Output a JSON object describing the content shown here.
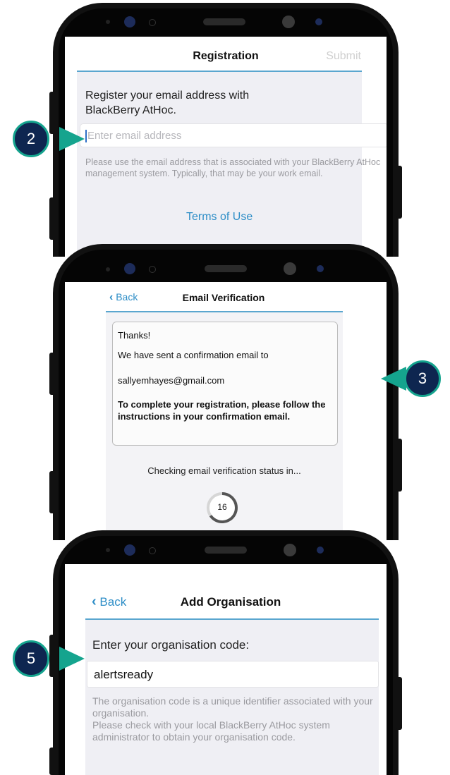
{
  "callouts": [
    "2",
    "3",
    "5"
  ],
  "registration": {
    "title": "Registration",
    "submit": "Submit",
    "heading": "Register your email address with BlackBerry AtHoc.",
    "email_placeholder": "Enter email address",
    "help": "Please use the email address that is associated with your BlackBerry AtHoc management system. Typically, that may be your work email.",
    "terms": "Terms of Use"
  },
  "verification": {
    "back": "Back",
    "title": "Email Verification",
    "thanks": "Thanks!",
    "sent": "We have sent a confirmation email to",
    "email": "sallyemhayes@gmail.com",
    "instructions": "To complete your registration, please follow the instructions in your confirmation email.",
    "checking": "Checking email verification status in...",
    "countdown": "16"
  },
  "organisation": {
    "back": "Back",
    "title": "Add Organisation",
    "prompt": "Enter your organisation code:",
    "code": "alertsready",
    "help": "The organisation code is a unique identifier associated with your organisation.\nPlease check with your local BlackBerry AtHoc system administrator to obtain your organisation code."
  },
  "colors": {
    "accent_blue": "#2e8ec7",
    "nav_rule": "#5aa6cf",
    "badge_fill": "#0e2650",
    "badge_ring": "#15a48e"
  }
}
